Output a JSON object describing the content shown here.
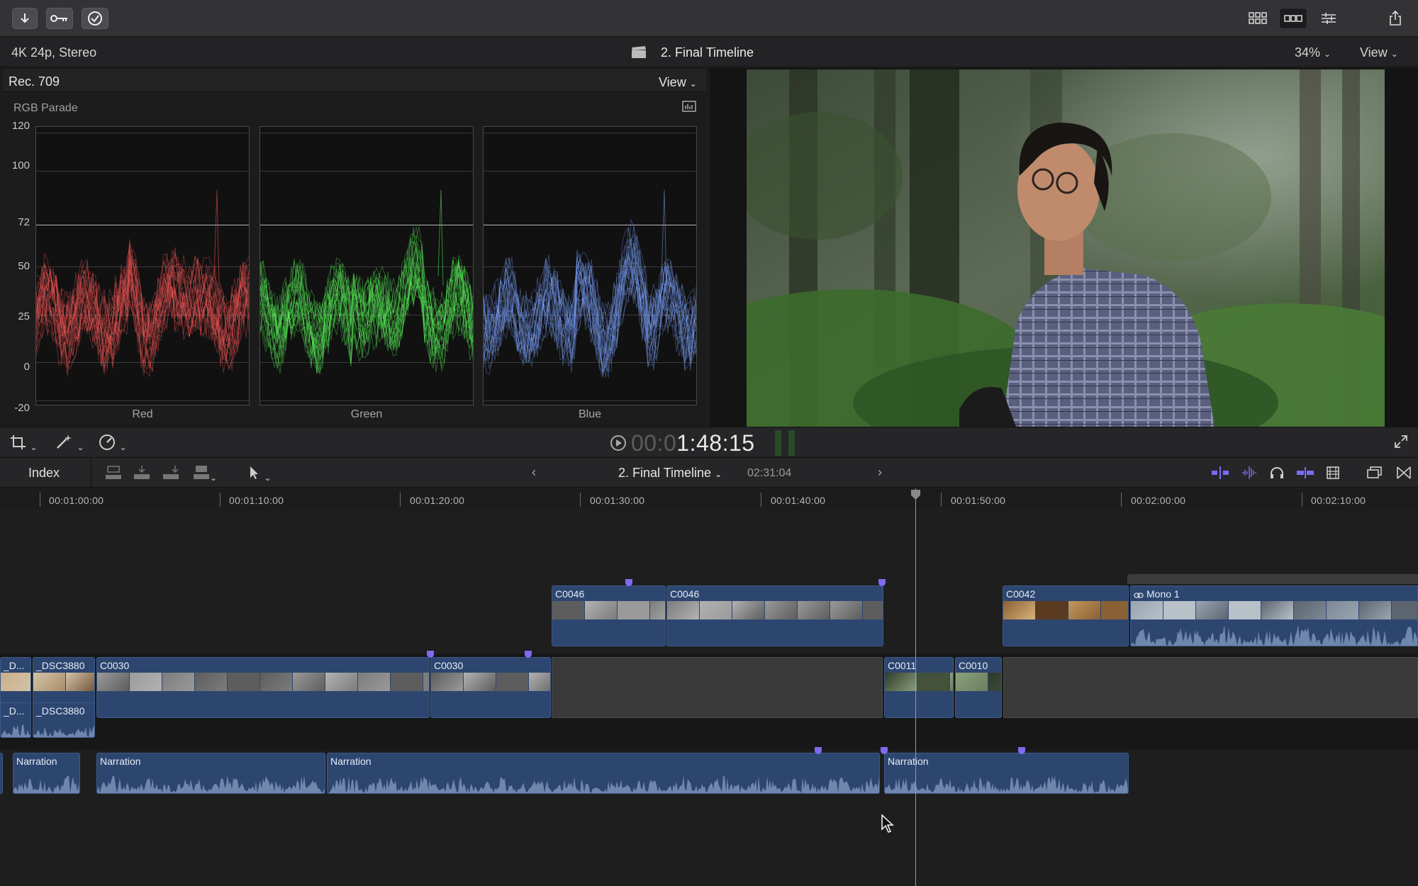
{
  "toolbar": {
    "import_icon": "down-arrow-icon",
    "keyword_icon": "key-icon",
    "check_icon": "checkmark-icon"
  },
  "infobar": {
    "format": "4K 24p, Stereo",
    "project_title": "2. Final Timeline",
    "zoom": "34%",
    "view": "View"
  },
  "scopes": {
    "color_space": "Rec. 709",
    "view": "View",
    "scope_type": "RGB Parade",
    "y_ticks": [
      "120",
      "100",
      "72",
      "50",
      "25",
      "0",
      "-20"
    ],
    "panels": [
      {
        "name": "Red",
        "color": "#ff5a5a"
      },
      {
        "name": "Green",
        "color": "#5cff5c"
      },
      {
        "name": "Blue",
        "color": "#7ba4ff"
      }
    ]
  },
  "transport": {
    "timecode_dim": "00:0",
    "timecode": "1:48:15"
  },
  "timeline_header": {
    "index": "Index",
    "title": "2. Final Timeline",
    "duration": "02:31:04"
  },
  "ruler": {
    "labels": [
      "00:01:00:00",
      "00:01:10:00",
      "00:01:20:00",
      "00:01:30:00",
      "00:01:40:00",
      "00:01:50:00",
      "00:02:00:00",
      "00:02:10:00"
    ]
  },
  "clips": {
    "connected": [
      "C0046",
      "C0046",
      "C0042",
      "Mono 1"
    ],
    "primary": [
      "_D...",
      "_DSC3880",
      "C0030",
      "C0030",
      "C0011",
      "C0010"
    ],
    "primary_audio": [
      "_D...",
      "_DSC3880"
    ],
    "narration": [
      "Narration",
      "Narration",
      "Narration",
      "Narration"
    ]
  },
  "colors": {
    "clip_blue": "#2d4670",
    "marker": "#7b6cf0",
    "accent_purple": "#7a6cf2"
  }
}
